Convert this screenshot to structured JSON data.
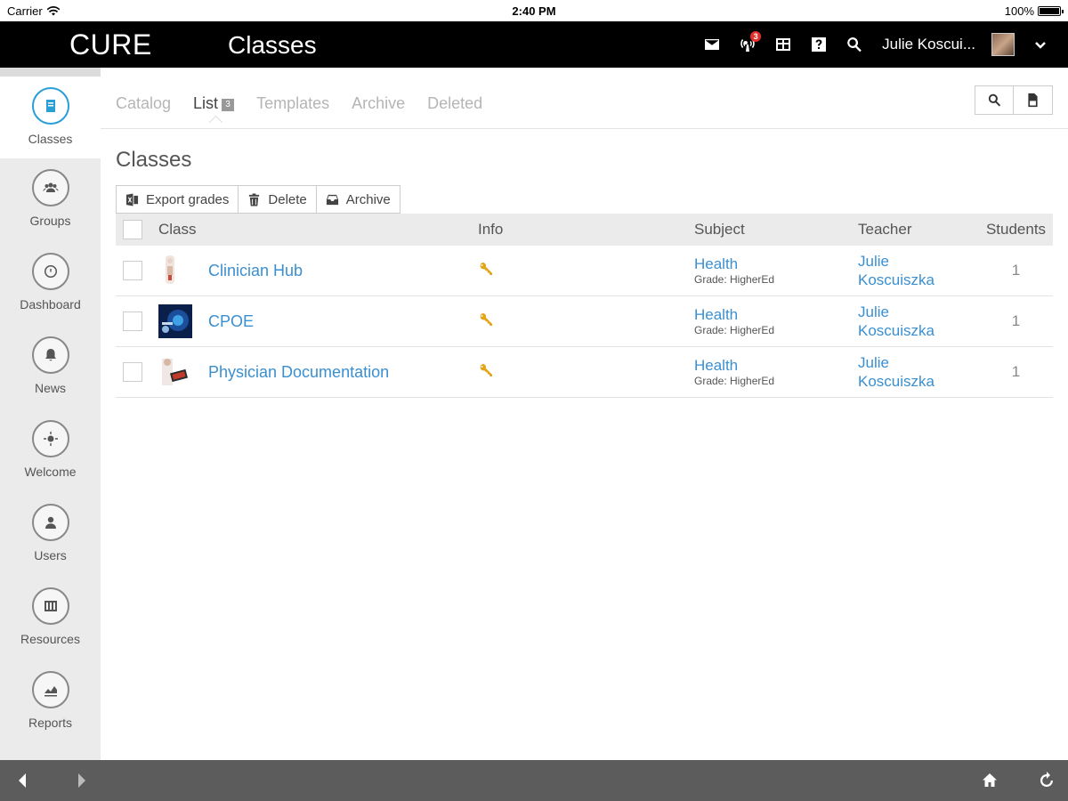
{
  "status_bar": {
    "carrier": "Carrier",
    "time": "2:40 PM",
    "battery": "100%"
  },
  "header": {
    "brand": "CURE",
    "title": "Classes",
    "notification_count": "3",
    "user_name": "Julie Koscui...",
    "icons": [
      "mail-icon",
      "notifications-icon",
      "grid-icon",
      "help-icon",
      "search-icon",
      "chevron-down-icon"
    ]
  },
  "sidebar": {
    "items": [
      {
        "label": "Classes",
        "icon": "classes-icon",
        "active": true
      },
      {
        "label": "Groups",
        "icon": "groups-icon"
      },
      {
        "label": "Dashboard",
        "icon": "dashboard-icon"
      },
      {
        "label": "News",
        "icon": "news-icon"
      },
      {
        "label": "Welcome",
        "icon": "welcome-icon"
      },
      {
        "label": "Users",
        "icon": "users-icon"
      },
      {
        "label": "Resources",
        "icon": "resources-icon"
      },
      {
        "label": "Reports",
        "icon": "reports-icon"
      }
    ]
  },
  "tabs": [
    {
      "label": "Catalog"
    },
    {
      "label": "List",
      "count": "3",
      "active": true
    },
    {
      "label": "Templates"
    },
    {
      "label": "Archive"
    },
    {
      "label": "Deleted"
    }
  ],
  "section_title": "Classes",
  "actions": {
    "export": "Export grades",
    "delete": "Delete",
    "archive": "Archive"
  },
  "table": {
    "columns": {
      "class": "Class",
      "info": "Info",
      "subject": "Subject",
      "teacher": "Teacher",
      "students": "Students"
    },
    "rows": [
      {
        "name": "Clinician Hub",
        "subject": "Health",
        "grade": "Grade: HigherEd",
        "teacher_first": "Julie",
        "teacher_last": "Koscuiszka",
        "students": "1"
      },
      {
        "name": "CPOE",
        "subject": "Health",
        "grade": "Grade: HigherEd",
        "teacher_first": "Julie",
        "teacher_last": "Koscuiszka",
        "students": "1"
      },
      {
        "name": "Physician Documentation",
        "subject": "Health",
        "grade": "Grade: HigherEd",
        "teacher_first": "Julie",
        "teacher_last": "Koscuiszka",
        "students": "1"
      }
    ]
  },
  "colors": {
    "link": "#3a8fd0",
    "accent": "#2a9fd6",
    "key": "#e3a518",
    "header_bg": "#000000",
    "toolbar_bg": "#5c5c5c"
  }
}
